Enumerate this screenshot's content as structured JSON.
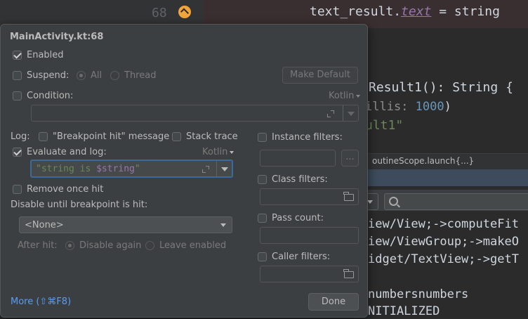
{
  "editor": {
    "line_number": "68",
    "code_line": {
      "prefix": "text_result.",
      "prop": "text",
      "suffix": " = string"
    },
    "line_fn": "Result1(): String {",
    "line_delay": {
      "hint": "illis:",
      "value": "1000",
      "close": ")"
    },
    "line_str": "ult1\"",
    "breadcrumb": "outineScope.launch{...}",
    "log_lines": [
      "iew/View;->computeFit",
      "iew/ViewGroup;->makeO",
      "idget/TextView;->getT",
      "numbersnumbers",
      "NITIALIZED"
    ]
  },
  "popup": {
    "title": "MainActivity.kt:68",
    "enabled_label": "Enabled",
    "suspend_label": "Suspend:",
    "suspend_all": "All",
    "suspend_thread": "Thread",
    "make_default": "Make Default",
    "condition_label": "Condition:",
    "condition_lang": "Kotlin",
    "condition_value": "",
    "log_label": "Log:",
    "bp_hit_msg": "\"Breakpoint hit\" message",
    "stack_trace": "Stack trace",
    "eval_log_label": "Evaluate and log:",
    "eval_lang": "Kotlin",
    "eval_expr": {
      "str_prefix": "\"string is ",
      "var": "$string",
      "str_suffix": "\""
    },
    "remove_once_hit": "Remove once hit",
    "disable_until": "Disable until breakpoint is hit:",
    "disable_select": "<None>",
    "after_hit": "After hit:",
    "disable_again": "Disable again",
    "leave_enabled": "Leave enabled",
    "instance_filters": "Instance filters:",
    "instance_more": "...",
    "class_filters": "Class filters:",
    "pass_count": "Pass count:",
    "caller_filters": "Caller filters:",
    "more_link": "More (⇧⌘F8)",
    "done": "Done",
    "states": {
      "enabled": true,
      "suspend": false,
      "suspend_all": true,
      "condition": false,
      "bp_hit_msg": false,
      "stack_trace": false,
      "eval_log": true,
      "remove_once_hit": false,
      "disable_again": true,
      "instance": false,
      "class": false,
      "pass": false,
      "caller": false
    }
  },
  "colors": {
    "accent": "#589df6",
    "breakpoint": "#f0a43a",
    "popup_bg": "#3c3f41",
    "editor_bg": "#2b2b2b"
  }
}
